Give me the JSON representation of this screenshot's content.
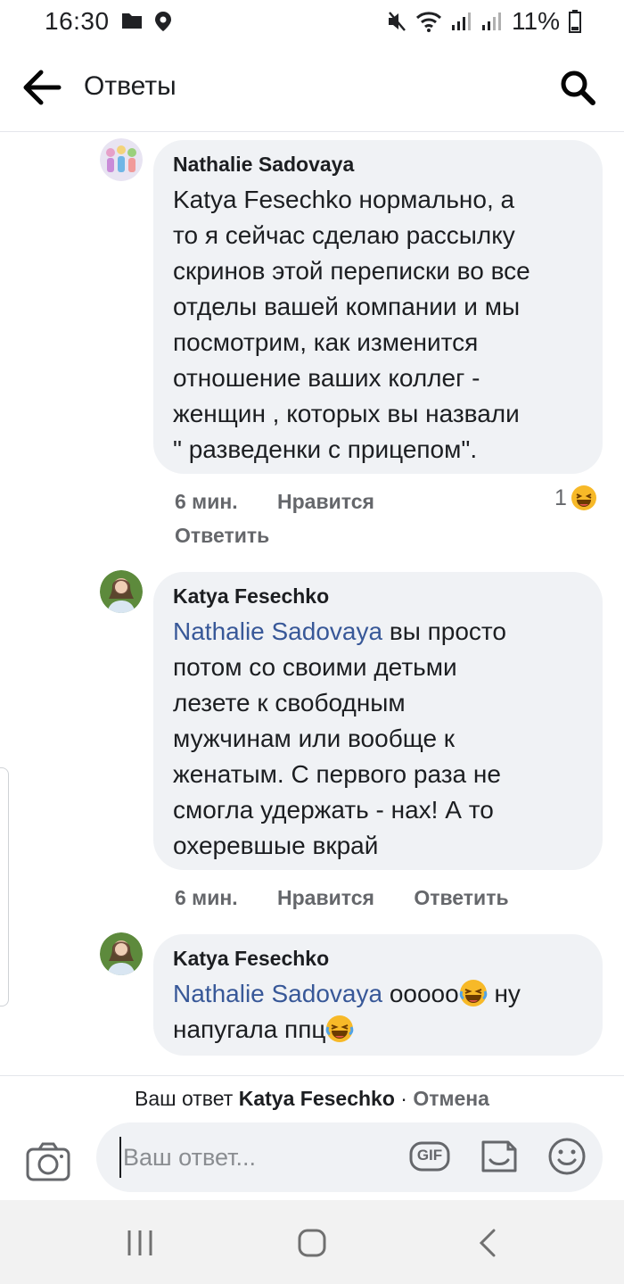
{
  "status_bar": {
    "time": "16:30",
    "battery": "11%"
  },
  "header": {
    "title": "Ответы"
  },
  "comments": [
    {
      "author": "Nathalie Sadovaya",
      "lines": [
        "Katya Fesechko нормально, а",
        "то я сейчас сделаю рассылку",
        "скринов этой переписки во все",
        "отделы вашей компании и мы",
        "посмотрим, как изменится",
        "отношение ваших коллег -",
        "женщин , которых вы назвали",
        "\" разведенки с прицепом\"."
      ],
      "time": "6 мин.",
      "like": "Нравится",
      "reply": "Ответить",
      "reaction_count": "1"
    },
    {
      "author": "Katya Fesechko",
      "mention": "Nathalie Sadovaya",
      "first_rest": " вы просто",
      "lines": [
        "потом со своими детьми",
        "лезете к свободным",
        "мужчинам или вообще к",
        "женатым. С первого раза не",
        "смогла удержать - нах! А то",
        "охеревшые вкрай"
      ],
      "time": "6 мин.",
      "like": "Нравится",
      "reply": "Ответить"
    },
    {
      "author": "Katya Fesechko",
      "mention": "Nathalie Sadovaya",
      "text1": " ооооо",
      "text2": " ну",
      "line2": "напугала ппц"
    }
  ],
  "reply_bar": {
    "prefix": "Ваш ответ",
    "target": "Katya Fesechko",
    "separator": " · ",
    "cancel": "Отмена",
    "placeholder": "Ваш ответ...",
    "gif_label": "GIF"
  },
  "colors": {
    "accent": "#385898",
    "bubble": "#f0f2f5",
    "muted": "#65676b"
  },
  "icons": [
    "back-arrow-icon",
    "search-icon",
    "laugh-emoji-icon",
    "camera-icon",
    "gif-icon",
    "sticker-icon",
    "smiley-icon",
    "recent-apps-icon",
    "home-icon",
    "back-nav-icon"
  ]
}
